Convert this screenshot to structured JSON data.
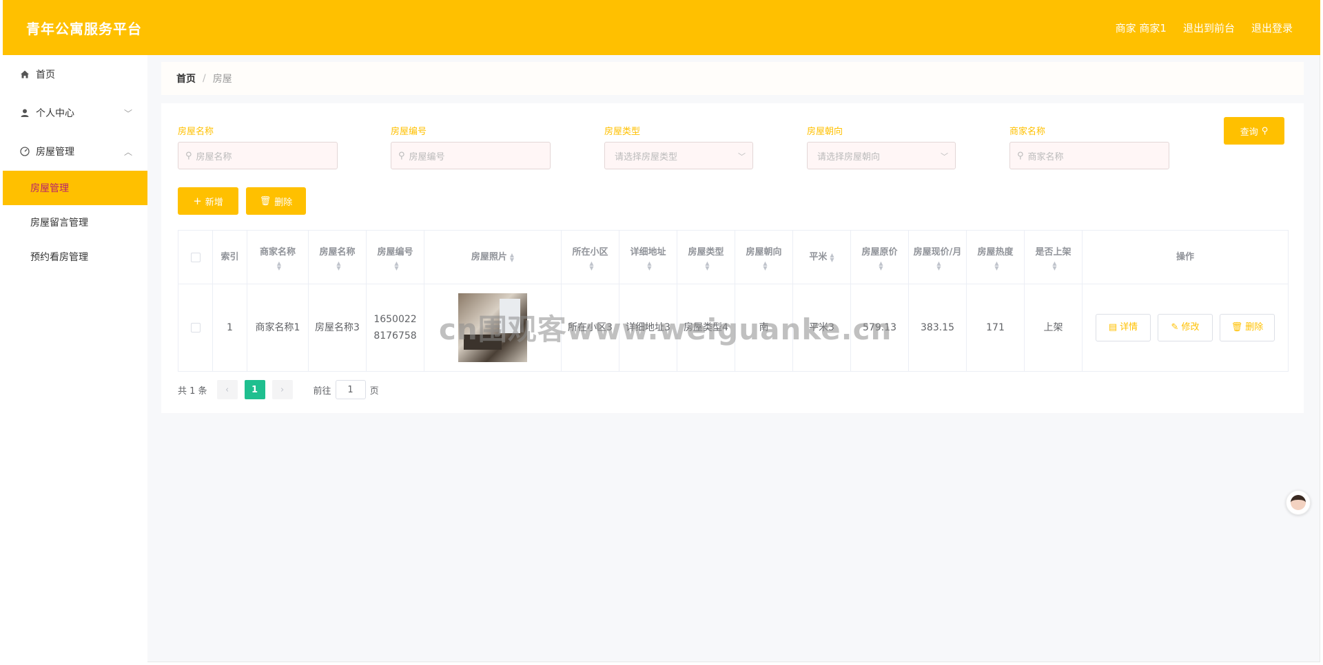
{
  "header": {
    "title": "青年公寓服务平台",
    "user": "商家 商家1",
    "to_front": "退出到前台",
    "logout": "退出登录"
  },
  "sidebar": {
    "items": [
      {
        "label": "首页",
        "icon": "home-icon"
      },
      {
        "label": "个人中心",
        "icon": "user-icon"
      },
      {
        "label": "房屋管理",
        "icon": "dashboard-icon"
      }
    ],
    "sub_items": [
      {
        "label": "房屋管理",
        "active": true
      },
      {
        "label": "房屋留言管理",
        "active": false
      },
      {
        "label": "预约看房管理",
        "active": false
      }
    ]
  },
  "breadcrumb": {
    "home": "首页",
    "sep": "/",
    "current": "房屋"
  },
  "search": {
    "fields": [
      {
        "label": "房屋名称",
        "placeholder": "房屋名称"
      },
      {
        "label": "房屋编号",
        "placeholder": "房屋编号"
      },
      {
        "label": "房屋类型",
        "placeholder": "请选择房屋类型"
      },
      {
        "label": "房屋朝向",
        "placeholder": "请选择房屋朝向"
      },
      {
        "label": "商家名称",
        "placeholder": "商家名称"
      }
    ],
    "query_label": "查询"
  },
  "toolbar": {
    "add_label": "新增",
    "delete_label": "删除"
  },
  "table": {
    "columns": [
      "索引",
      "商家名称",
      "房屋名称",
      "房屋编号",
      "房屋照片",
      "所在小区",
      "详细地址",
      "房屋类型",
      "房屋朝向",
      "平米",
      "房屋原价",
      "房屋现价/月",
      "房屋热度",
      "是否上架",
      "操作"
    ],
    "rows": [
      {
        "index": "1",
        "merchant": "商家名称1",
        "name": "房屋名称3",
        "code": "16500228176758",
        "community": "所在小区3",
        "address": "详细地址3",
        "type": "房屋类型4",
        "orientation": "南",
        "area": "平米3",
        "orig_price": "579.13",
        "price": "383.15",
        "heat": "171",
        "listed": "上架"
      }
    ],
    "ops": {
      "detail": "详情",
      "edit": "修改",
      "delete": "删除"
    }
  },
  "pagination": {
    "total": "共 1 条",
    "page": "1",
    "goto": "前往",
    "page_unit": "页",
    "goto_value": "1"
  },
  "watermark": "cn围观客www.weiguanke.cn",
  "colors": {
    "accent": "#ffc000",
    "page_active": "#1fbf8f",
    "active_text": "#b8236b"
  }
}
